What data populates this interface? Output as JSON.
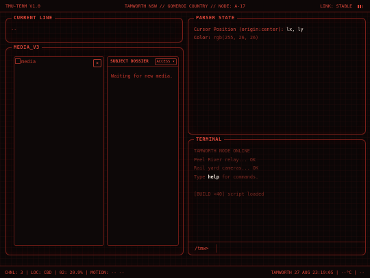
{
  "topbar": {
    "app_title": "TMU-TERM V1.0",
    "location": "TAMWORTH NSW // GOMEROI COUNTRY // NODE: A-17",
    "link_status": "LINK: STABLE"
  },
  "current_line": {
    "title": "CURRENT LINE",
    "value": "--"
  },
  "media": {
    "title": "MEDIA_V3",
    "image_alt": "media",
    "close_label": "×",
    "dossier": {
      "title": "SUBJECT DOSSIER",
      "select_value": "ACCESS",
      "body": "Waiting for new media."
    }
  },
  "parser": {
    "title": "PARSER STATE",
    "cursor_label": "Cursor Position (origin:center):",
    "cursor_x": "lx",
    "cursor_sep": ",",
    "cursor_y": "ly",
    "color_label": "Color:",
    "color_value": "rgb(255, 26, 26)"
  },
  "terminal": {
    "title": "TERMINAL",
    "line1": "TAMWORTH NODE ONLINE",
    "line2": "Peel River relay... OK",
    "line3": "Rail yard cameras... OK",
    "line4_pre": "Type",
    "line4_cmd": "help",
    "line4_post": "for commands.",
    "line5": "[BUILD <40] script loaded",
    "prompt": "/tmw>"
  },
  "statusbar": {
    "left": "CHNL: 3 | LOC: CBD | 02: 20.9% | MOTION: -- --",
    "right": "TAMWORTH 27 AUG 23:19:05  |  --°C |  --"
  },
  "colors": {
    "accent": "#d8463a",
    "border": "#7a1f19",
    "background": "#0b0606",
    "highlight": "#f0e2d8"
  }
}
